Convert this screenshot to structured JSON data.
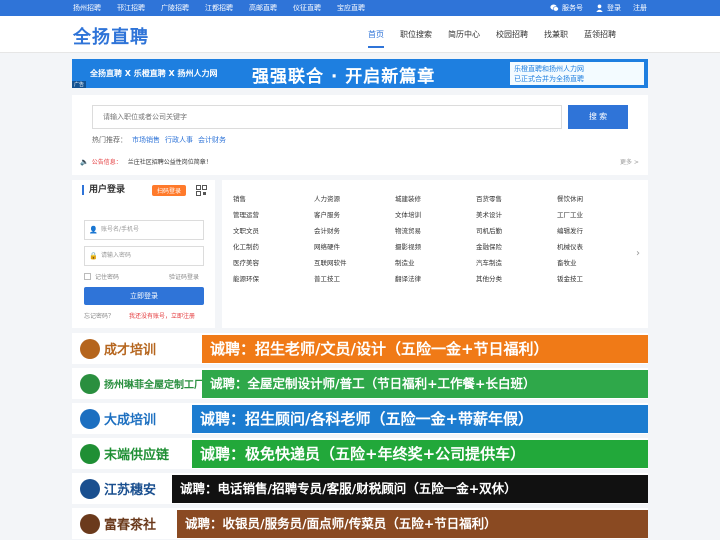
{
  "topbar": {
    "cities": [
      "扬州招聘",
      "邗江招聘",
      "广陵招聘",
      "江都招聘",
      "高邮直聘",
      "仪征直聘",
      "宝应直聘"
    ],
    "service": "服务号",
    "login": "登录",
    "register": "注册"
  },
  "header": {
    "logo": "全扬直聘",
    "nav": [
      "首页",
      "职位搜索",
      "简历中心",
      "校园招聘",
      "找兼职",
      "蓝领招聘"
    ]
  },
  "banner": {
    "left": "全扬直聘 X 乐橙直聘 X 扬州人力网",
    "middle": "强强联合 · 开启新篇章",
    "right_line1": "乐橙直聘和扬州人力网",
    "right_line2": "已正式合并为全扬直聘",
    "ad_tag": "广告"
  },
  "search": {
    "placeholder": "请输入职位或者公司关键字",
    "button": "搜 索",
    "hot_label": "热门推荐：",
    "hot_links": [
      "市场销售",
      "行政人事",
      "会计财务"
    ],
    "notice_label": "公告信息：",
    "notice_text": "兰庄社区招聘公益性岗位简章！",
    "more": "更多 >"
  },
  "login": {
    "title": "用户登录",
    "qr_button": "扫码登录",
    "account_placeholder": "账号名/手机号",
    "password_placeholder": "请输入密码",
    "remember": "记住密码",
    "verify": "验证码登录",
    "submit": "立即登录",
    "forgot": "忘记密码？",
    "signup": "我还没有账号，立即注册"
  },
  "categories": [
    "销售",
    "人力资源",
    "城建装修",
    "百货零售",
    "餐饮休闲",
    "管理运营",
    "客户服务",
    "文体培训",
    "美术设计",
    "工厂工业",
    "文职文员",
    "会计财务",
    "物流贸易",
    "司机后勤",
    "编辑发行",
    "化工制药",
    "网络硬件",
    "摄影视频",
    "金融保险",
    "机械仪表",
    "医疗美容",
    "互联网软件",
    "制造业",
    "汽车制造",
    "畜牧业",
    "能源环保",
    "普工技工",
    "翻译法律",
    "其他分类",
    "钣金技工"
  ],
  "ads": [
    {
      "logo": "成才培训",
      "text": "诚聘：招生老师/文员/设计（五险一金+节日福利）",
      "color": "#f07a17",
      "logo_color": "#b5651d"
    },
    {
      "logo": "扬州琳菲全屋定制工厂直销",
      "text": "诚聘：全屋定制设计师/普工（节日福利+工作餐+长白班）",
      "color": "#2fa84a",
      "logo_color": "#2a8f3f"
    },
    {
      "logo": "大成培训",
      "text": "诚聘：招生顾问/各科老师（五险一金+带薪年假）",
      "color": "#1c7cd0",
      "logo_color": "#1c6fc0"
    },
    {
      "logo": "末端供应链",
      "text": "诚聘：极免快递员（五险+年终奖+公司提供车）",
      "color": "#22a83a",
      "logo_color": "#1f8f34"
    },
    {
      "logo": "江苏穗安",
      "text": "诚聘：电话销售/招聘专员/客服/财税顾问（五险一金+双休）",
      "color": "#111111",
      "logo_color": "#1a4f8f"
    },
    {
      "logo": "富春茶社",
      "text": "诚聘：收银员/服务员/面点师/传菜员（五险+节日福利）",
      "color": "#8a4a22",
      "logo_color": "#6b3a1c"
    }
  ],
  "colors": {
    "primary": "#2f74d8",
    "accent": "#ff7a2b",
    "alert": "#e4393c"
  },
  "icons": [
    "wechat-icon",
    "user-icon",
    "qrcode-icon",
    "user-field-icon",
    "lock-icon",
    "speaker-icon",
    "chevron-right-icon"
  ]
}
